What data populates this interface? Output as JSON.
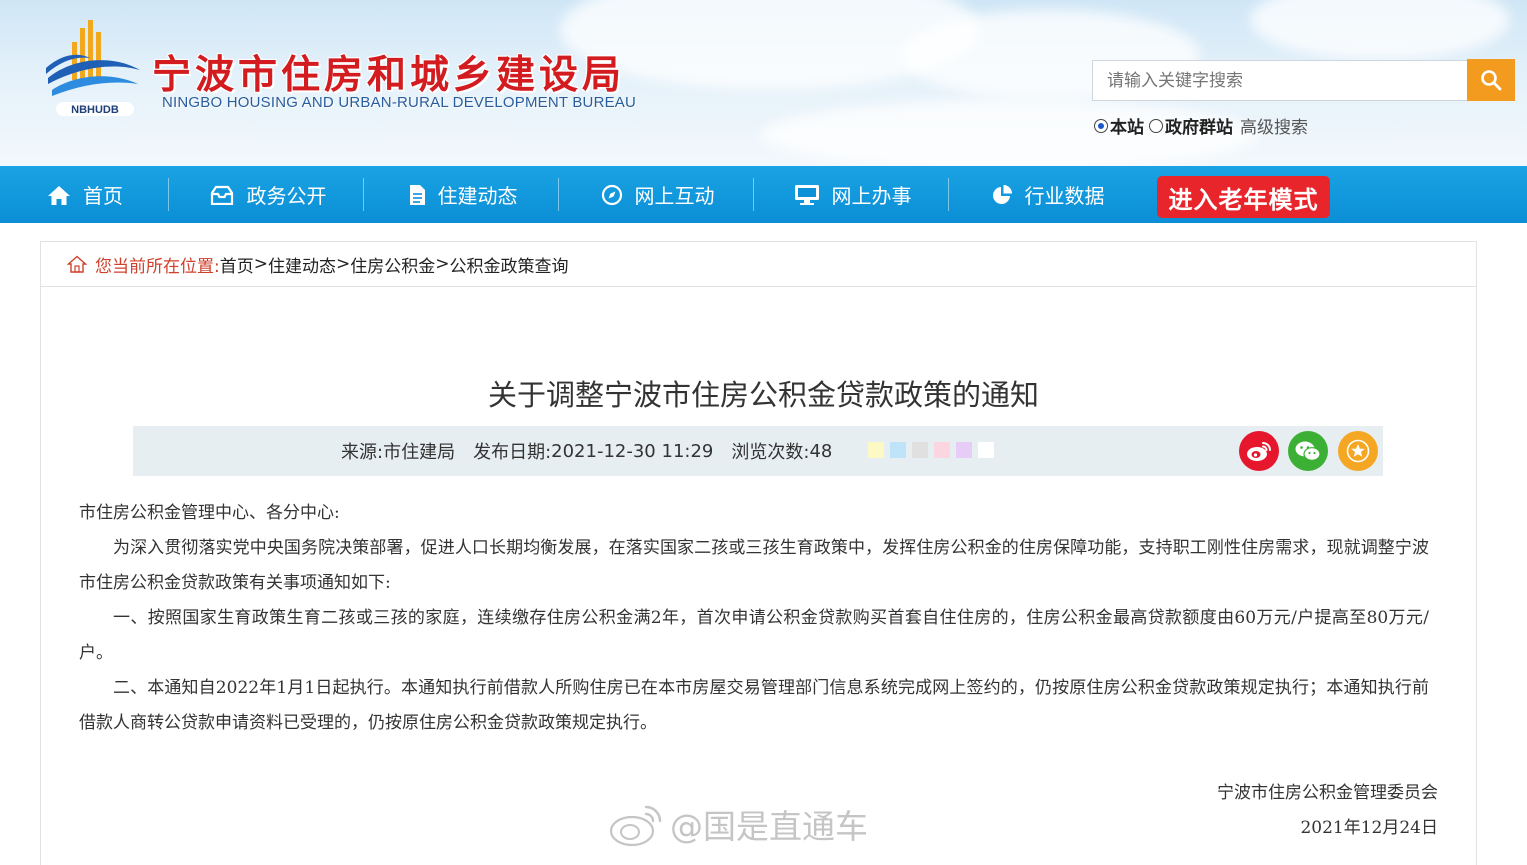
{
  "header": {
    "logo_abbr": "NBHUDB",
    "title": "宁波市住房和城乡建设局",
    "subtitle": "NINGBO HOUSING AND URBAN-RURAL DEVELOPMENT BUREAU",
    "search": {
      "placeholder": "请输入关键字搜索",
      "scope_options": [
        "本站",
        "政府群站"
      ],
      "scope_selected": "本站",
      "advanced_label": "高级搜索"
    }
  },
  "nav": {
    "items": [
      {
        "label": "首页",
        "icon": "home-icon"
      },
      {
        "label": "政务公开",
        "icon": "inbox-icon"
      },
      {
        "label": "住建动态",
        "icon": "document-icon"
      },
      {
        "label": "网上互动",
        "icon": "compass-icon"
      },
      {
        "label": "网上办事",
        "icon": "monitor-icon"
      },
      {
        "label": "行业数据",
        "icon": "pie-chart-icon"
      }
    ],
    "elder_mode_label": "进入老年模式",
    "colors": {
      "bar": "#0b8ed5",
      "elder_button": "#e8252b"
    }
  },
  "breadcrumb": {
    "prefix": "您当前所在位置:",
    "items": [
      "首页",
      "住建动态",
      "住房公积金",
      "公积金政策查询"
    ],
    "separator": ">"
  },
  "article": {
    "title": "关于调整宁波市住房公积金贷款政策的通知",
    "meta": {
      "source_label": "来源:",
      "source": "市住建局",
      "date_label": "发布日期:",
      "date": "2021-12-30 11:29",
      "views_label": "浏览次数:",
      "views": "48"
    },
    "bg_swatches": [
      "#fdf9c4",
      "#bfe3f9",
      "#e6e6e6",
      "#fbd6e0",
      "#e6ccf7",
      "#ffffff"
    ],
    "share": [
      {
        "icon": "weibo-icon",
        "color": "#e6162d"
      },
      {
        "icon": "wechat-icon",
        "color": "#3cb034"
      },
      {
        "icon": "favorite-star-icon",
        "color": "#f5a623"
      }
    ],
    "salutation": "市住房公积金管理中心、各分中心:",
    "paragraphs": [
      "为深入贯彻落实党中央国务院决策部署，促进人口长期均衡发展，在落实国家二孩或三孩生育政策中，发挥住房公积金的住房保障功能，支持职工刚性住房需求，现就调整宁波市住房公积金贷款政策有关事项通知如下:",
      "一、按照国家生育政策生育二孩或三孩的家庭，连续缴存住房公积金满2年，首次申请公积金贷款购买首套自住住房的，住房公积金最高贷款额度由60万元/户提高至80万元/户。",
      "二、本通知自2022年1月1日起执行。本通知执行前借款人所购住房已在本市房屋交易管理部门信息系统完成网上签约的，仍按原住房公积金贷款政策规定执行；本通知执行前借款人商转公贷款申请资料已受理的，仍按原住房公积金贷款政策规定执行。"
    ],
    "signature_org": "宁波市住房公积金管理委员会",
    "signature_date": "2021年12月24日"
  },
  "watermark": "@国是直通车"
}
